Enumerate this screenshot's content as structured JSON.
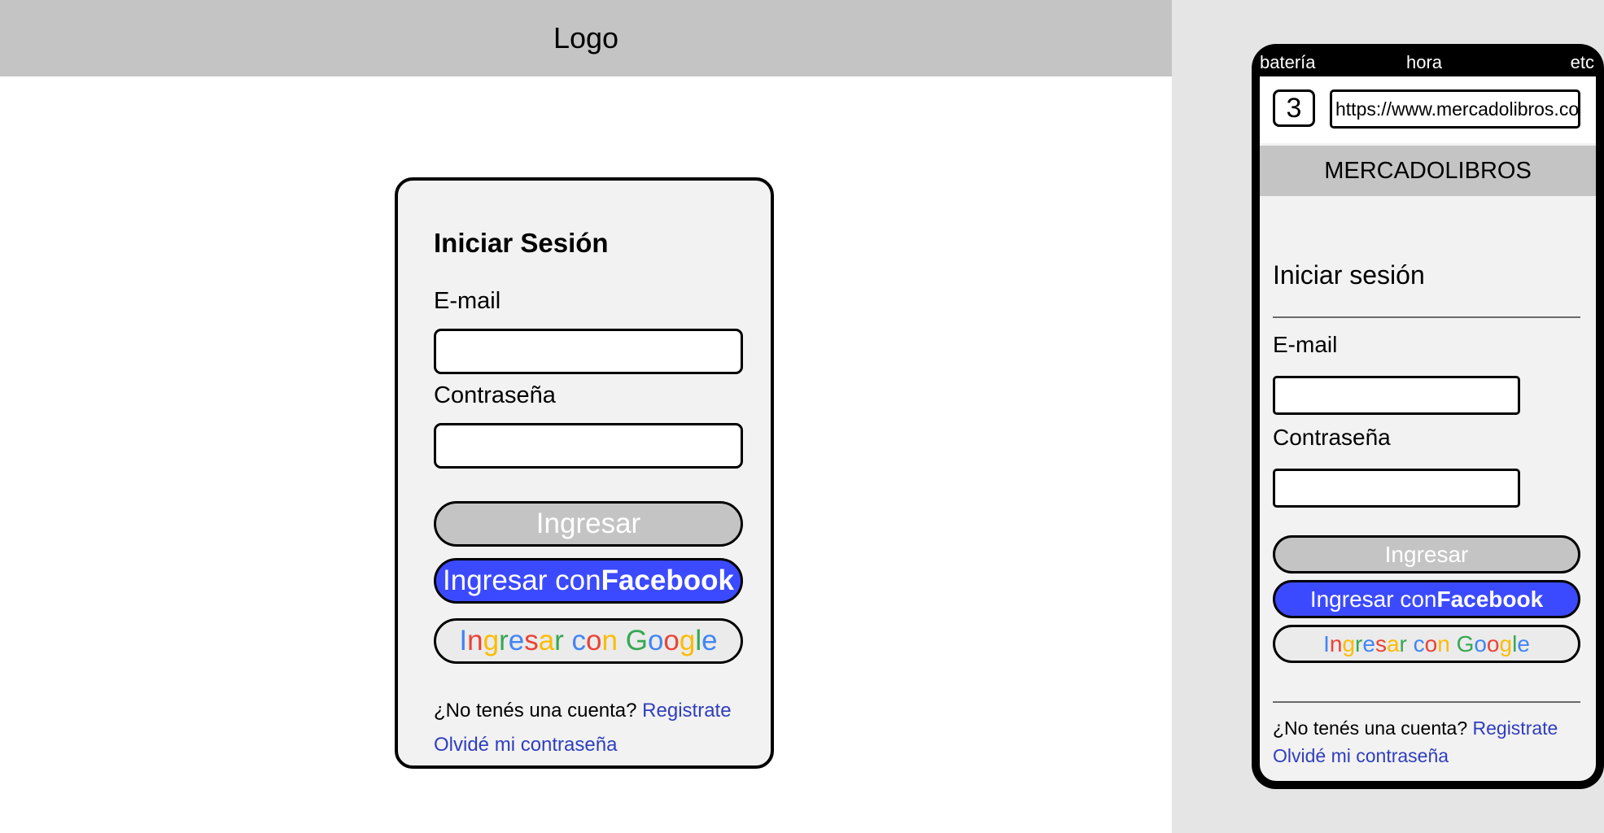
{
  "desktop": {
    "header": {
      "logo": "Logo"
    },
    "login": {
      "title": "Iniciar Sesión",
      "email_label": "E-mail",
      "email_value": "",
      "password_label": "Contraseña",
      "password_value": "",
      "submit_label": "Ingresar",
      "facebook_prefix": "Ingresar con ",
      "facebook_brand": "Facebook",
      "google_label": "Ingresar con Google",
      "no_account_text": "¿No tenés una cuenta? ",
      "register_link": "Registrate",
      "forgot_link": "Olvidé mi contraseña"
    }
  },
  "mobile": {
    "status": {
      "battery": "batería",
      "time": "hora",
      "etc": "etc"
    },
    "browser": {
      "tab_count": "3",
      "url": "https://www.mercadolibros.com"
    },
    "header": {
      "title": "MERCADOLIBROS"
    },
    "login": {
      "title": "Iniciar sesión",
      "email_label": "E-mail",
      "password_label": "Contraseña",
      "submit_label": "Ingresar",
      "facebook_prefix": "Ingresar con ",
      "facebook_brand": "Facebook",
      "google_label": "Ingresar con Google",
      "no_account_text": "¿No tenés una cuenta? ",
      "register_link": "Registrate",
      "forgot_link": "Olvidé mi contraseña"
    }
  },
  "colors": {
    "header_gray": "#c4c4c4",
    "card_bg": "#f2f2f2",
    "facebook_blue": "#3c4aff",
    "link_blue": "#2f3ebd",
    "google_palette": [
      "#4285f4",
      "#ea4335",
      "#fbbc05",
      "#34a853"
    ]
  }
}
